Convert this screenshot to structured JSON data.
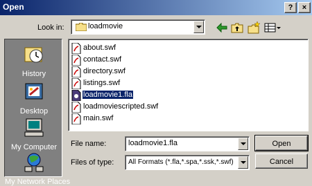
{
  "window": {
    "title": "Open",
    "help_label": "?",
    "close_label": "×"
  },
  "lookin": {
    "label": "Look in:",
    "value": "loadmovie"
  },
  "toolbar": {
    "back_icon": "back-arrow-icon",
    "up_icon": "up-folder-icon",
    "newfolder_icon": "new-folder-icon",
    "views_icon": "views-menu-icon"
  },
  "places": [
    {
      "label": "History",
      "icon": "history-icon"
    },
    {
      "label": "Desktop",
      "icon": "desktop-icon"
    },
    {
      "label": "My Computer",
      "icon": "my-computer-icon"
    },
    {
      "label": "My Network Places",
      "icon": "network-icon"
    }
  ],
  "files": [
    {
      "name": "about.swf",
      "type": "swf"
    },
    {
      "name": "contact.swf",
      "type": "swf"
    },
    {
      "name": "directory.swf",
      "type": "swf"
    },
    {
      "name": "listings.swf",
      "type": "swf"
    },
    {
      "name": "loadmovie1.fla",
      "type": "fla",
      "selected": true
    },
    {
      "name": "loadmoviescripted.swf",
      "type": "swf"
    },
    {
      "name": "main.swf",
      "type": "swf"
    }
  ],
  "filename": {
    "label": "File name:",
    "value": "loadmovie1.fla"
  },
  "filetype": {
    "label": "Files of type:",
    "value": "All Formats (*.fla,*.spa,*.ssk,*.swf)"
  },
  "buttons": {
    "open": "Open",
    "cancel": "Cancel"
  },
  "colors": {
    "titlebar": "#0a246a",
    "selection": "#0a246a",
    "places_bg": "#808080",
    "dialog_bg": "#d4d0c8"
  }
}
